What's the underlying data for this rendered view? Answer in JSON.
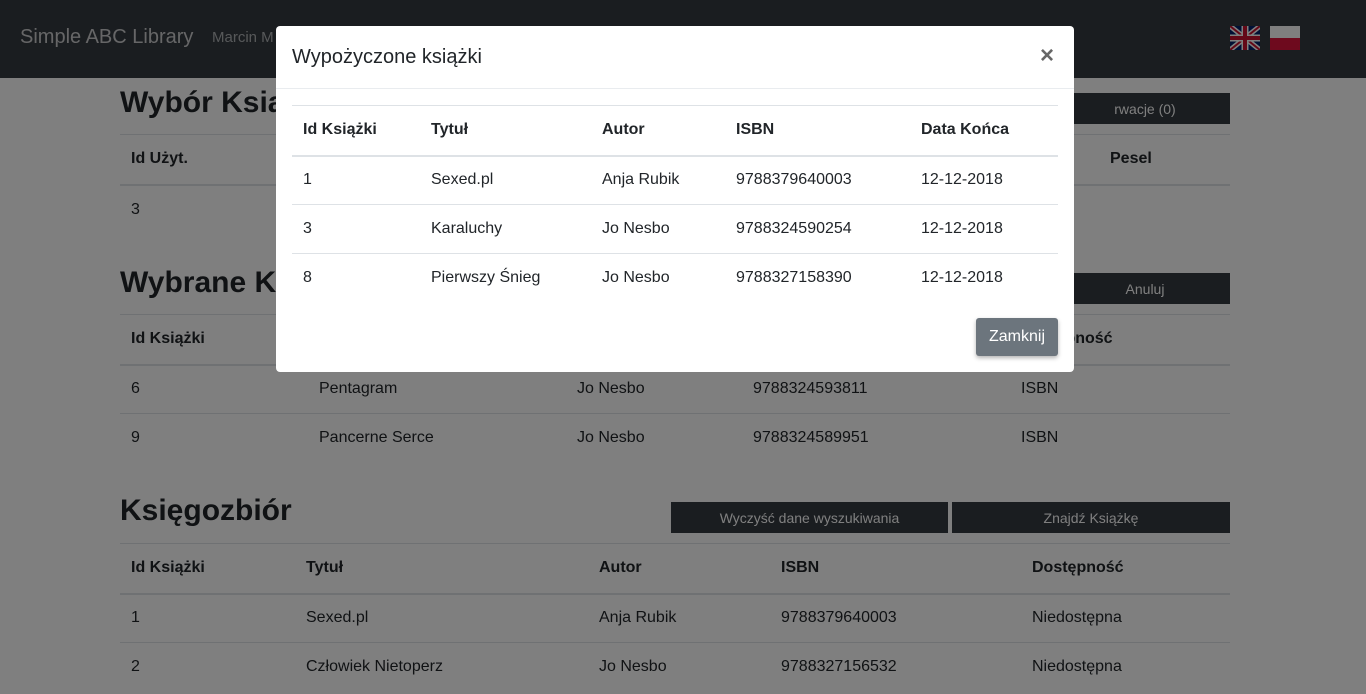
{
  "navbar": {
    "brand": "Simple ABC Library",
    "user": "Marcin M"
  },
  "section1": {
    "title": "Wybór Książki",
    "button": "rwacje (0)",
    "headers": [
      "Id Użyt.",
      "",
      "",
      "",
      "Pesel"
    ],
    "rows": [
      [
        "3",
        "",
        "",
        "",
        ""
      ]
    ]
  },
  "section2": {
    "title": "Wybrane Książki",
    "button": "Anuluj",
    "headers": [
      "Id Książki",
      "",
      "",
      "",
      "Dostępność"
    ],
    "rows": [
      [
        "6",
        "Pentagram",
        "Jo Nesbo",
        "9788324593811",
        "ISBN"
      ],
      [
        "9",
        "Pancerne Serce",
        "Jo Nesbo",
        "9788324589951",
        "ISBN"
      ]
    ]
  },
  "section3": {
    "title": "Księgozbiór",
    "clear_button": "Wyczyść dane wyszukiwania",
    "find_button": "Znajdź Książkę",
    "headers": [
      "Id Książki",
      "Tytuł",
      "Autor",
      "ISBN",
      "Dostępność"
    ],
    "rows": [
      [
        "1",
        "Sexed.pl",
        "Anja Rubik",
        "9788379640003",
        "Niedostępna"
      ],
      [
        "2",
        "Człowiek Nietoperz",
        "Jo Nesbo",
        "9788327156532",
        "Niedostępna"
      ]
    ]
  },
  "modal": {
    "title": "Wypożyczone książki",
    "close_symbol": "×",
    "headers": [
      "Id Książki",
      "Tytuł",
      "Autor",
      "ISBN",
      "Data Końca"
    ],
    "rows": [
      [
        "1",
        "Sexed.pl",
        "Anja Rubik",
        "9788379640003",
        "12-12-2018"
      ],
      [
        "3",
        "Karaluchy",
        "Jo Nesbo",
        "9788324590254",
        "12-12-2018"
      ],
      [
        "8",
        "Pierwszy Śnieg",
        "Jo Nesbo",
        "9788327158390",
        "12-12-2018"
      ]
    ],
    "close_button": "Zamknij"
  }
}
